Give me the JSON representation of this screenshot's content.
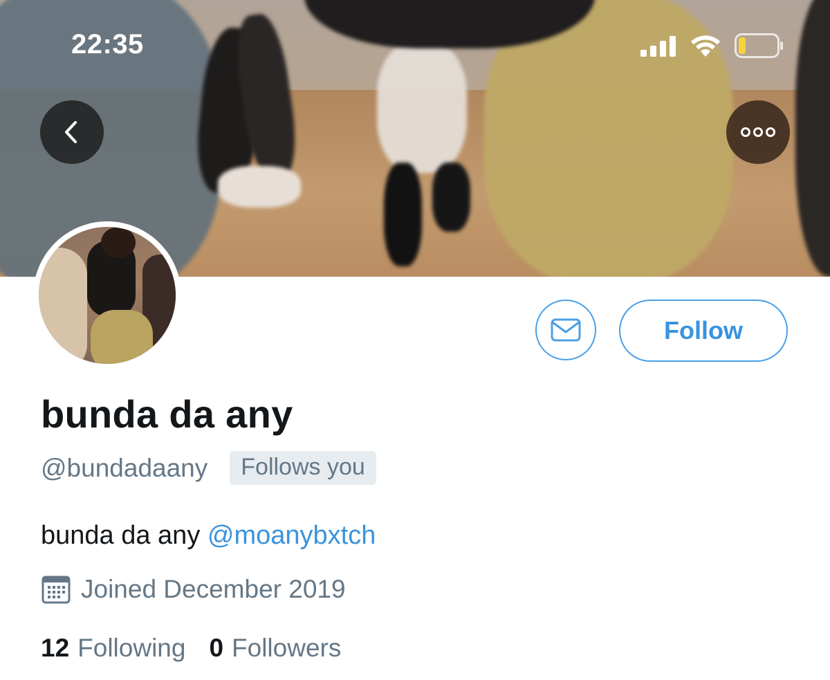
{
  "status_bar": {
    "time": "22:35"
  },
  "header": {
    "back_icon": "chevron-left-icon",
    "more_icon": "more-horizontal-icon"
  },
  "actions": {
    "message_icon": "envelope-icon",
    "follow_label": "Follow"
  },
  "profile": {
    "display_name": "bunda da any",
    "handle": "@bundadaany",
    "follows_you_badge": "Follows you",
    "bio_text": "bunda da any ",
    "bio_mention": "@moanybxtch",
    "joined": "Joined December 2019",
    "following_count": "12",
    "following_label": "Following",
    "followers_count": "0",
    "followers_label": "Followers"
  },
  "colors": {
    "accent": "#3a93dd",
    "text_primary": "#14171a",
    "text_secondary": "#657786",
    "badge_bg": "#e6ecf0"
  }
}
